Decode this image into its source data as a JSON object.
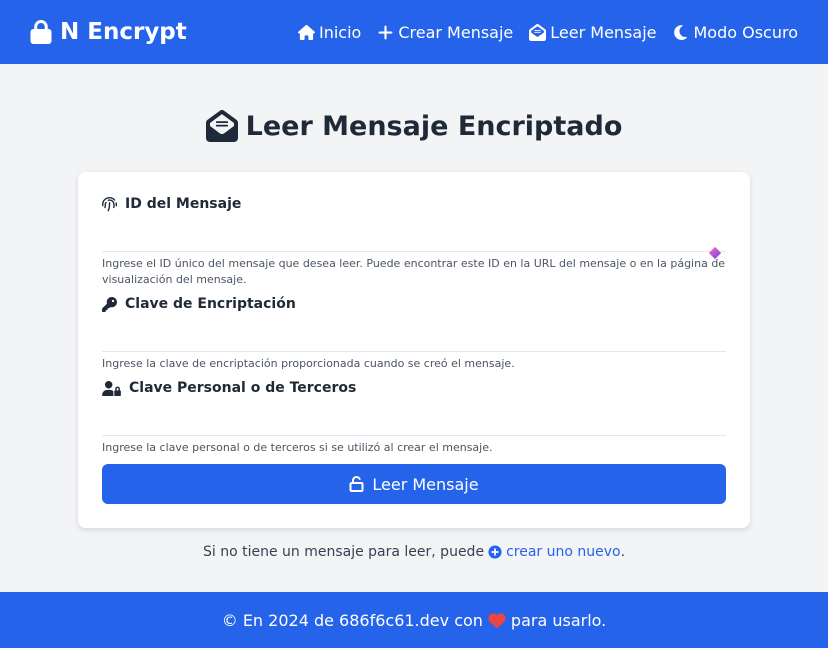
{
  "nav": {
    "brand": "N Encrypt",
    "links": [
      {
        "label": "Inicio",
        "icon": "home-icon"
      },
      {
        "label": "Crear Mensaje",
        "icon": "plus-icon"
      },
      {
        "label": "Leer Mensaje",
        "icon": "envelope-open-icon"
      },
      {
        "label": "Modo Oscuro",
        "icon": "moon-icon"
      }
    ]
  },
  "page": {
    "title": "Leer Mensaje Encriptado"
  },
  "form": {
    "message_id": {
      "label": "ID del Mensaje",
      "value": "",
      "help": "Ingrese el ID único del mensaje que desea leer. Puede encontrar este ID en la URL del mensaje o en la página de visualización del mensaje."
    },
    "encryption_key": {
      "label": "Clave de Encriptación",
      "value": "",
      "help": "Ingrese la clave de encriptación proporcionada cuando se creó el mensaje."
    },
    "personal_key": {
      "label": "Clave Personal o de Terceros",
      "value": "",
      "help": "Ingrese la clave personal o de terceros si se utilizó al crear el mensaje."
    },
    "submit_label": "Leer Mensaje"
  },
  "note": {
    "text": "Si no tiene un mensaje para leer, puede",
    "link": "crear uno nuevo",
    "suffix": "."
  },
  "footer": {
    "prefix": "© En 2024 de 686f6c61.dev con",
    "suffix": "para usarlo."
  },
  "colors": {
    "primary": "#2563eb",
    "background": "#f3f4f6",
    "heart": "#ef4444"
  }
}
